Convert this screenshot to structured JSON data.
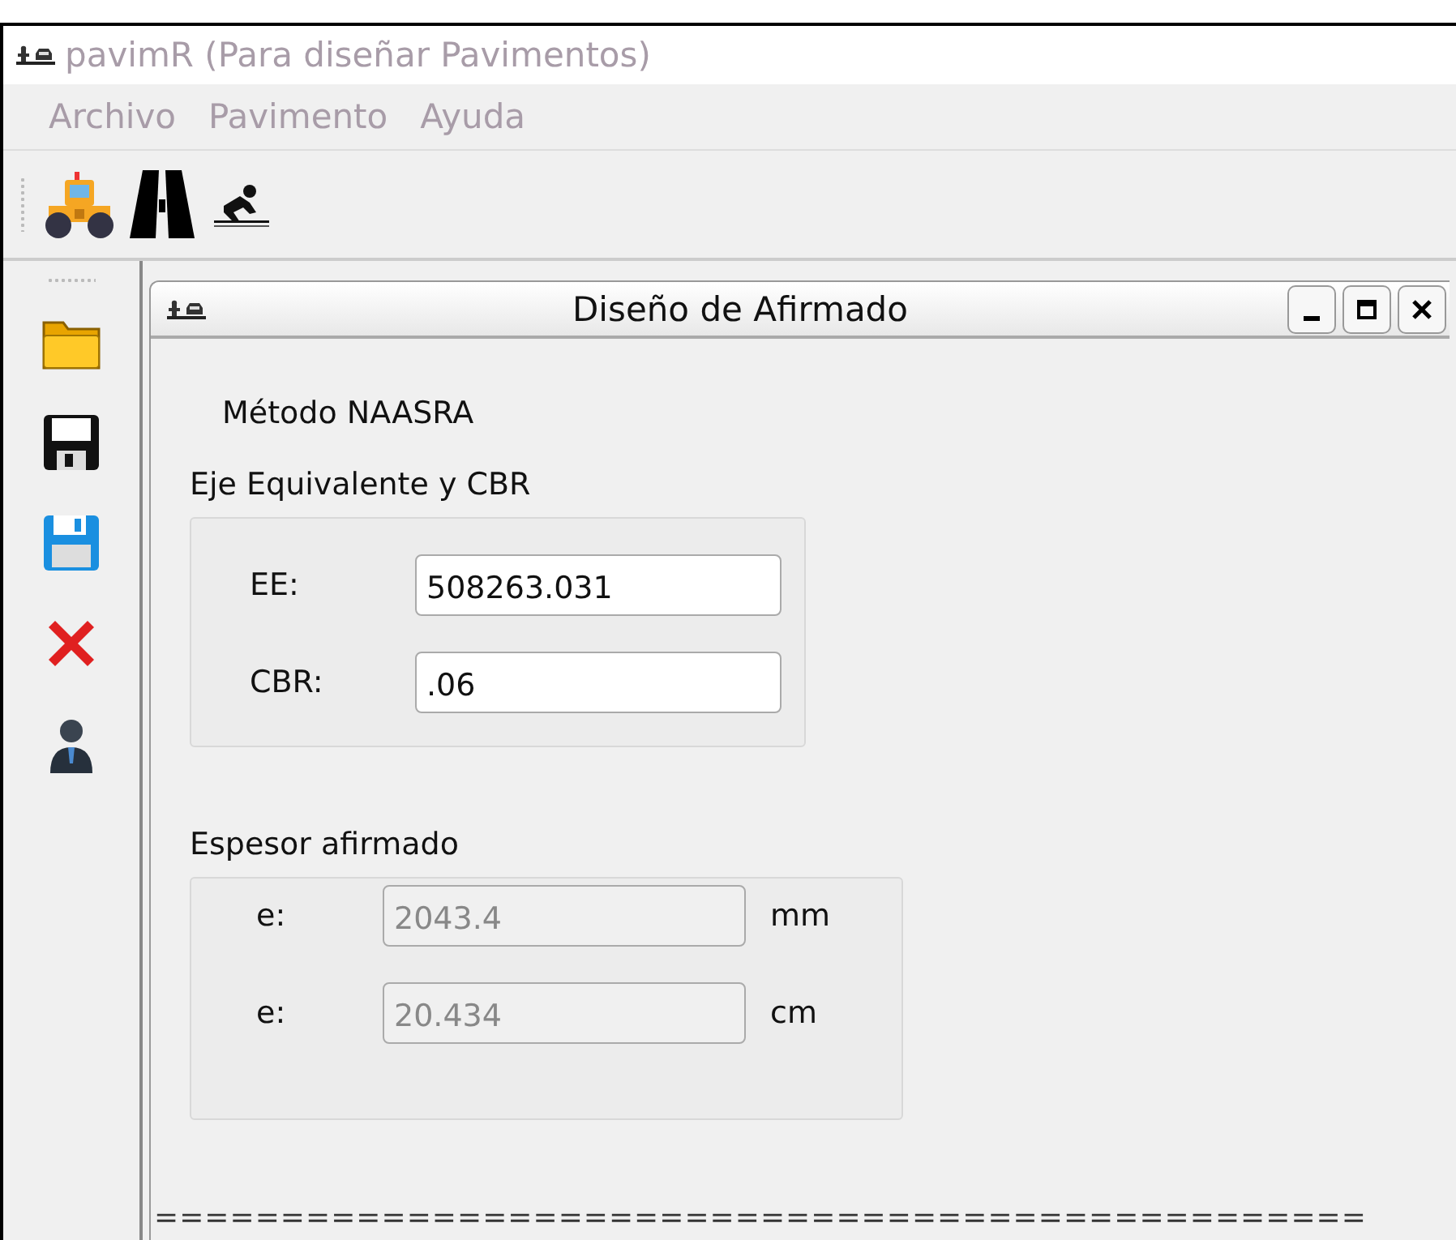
{
  "window": {
    "title": "pavimR (Para diseñar Pavimentos)"
  },
  "menu": [
    {
      "label": "Archivo"
    },
    {
      "label": "Pavimento"
    },
    {
      "label": "Ayuda"
    }
  ],
  "child_window": {
    "title": "Diseño de Afirmado",
    "method": "Método NAASRA",
    "input_group": {
      "title": "Eje Equivalente y CBR",
      "fields": [
        {
          "label": "EE:",
          "value": "508263.031",
          "disabled": false
        },
        {
          "label": "CBR:",
          "value": ".06",
          "disabled": false
        }
      ]
    },
    "output_group": {
      "title": "Espesor afirmado",
      "fields": [
        {
          "label": "e:",
          "value": "2043.4",
          "unit": "mm",
          "disabled": true
        },
        {
          "label": "e:",
          "value": "20.434",
          "unit": "cm",
          "disabled": true
        }
      ]
    },
    "separator_text": "================================================"
  }
}
